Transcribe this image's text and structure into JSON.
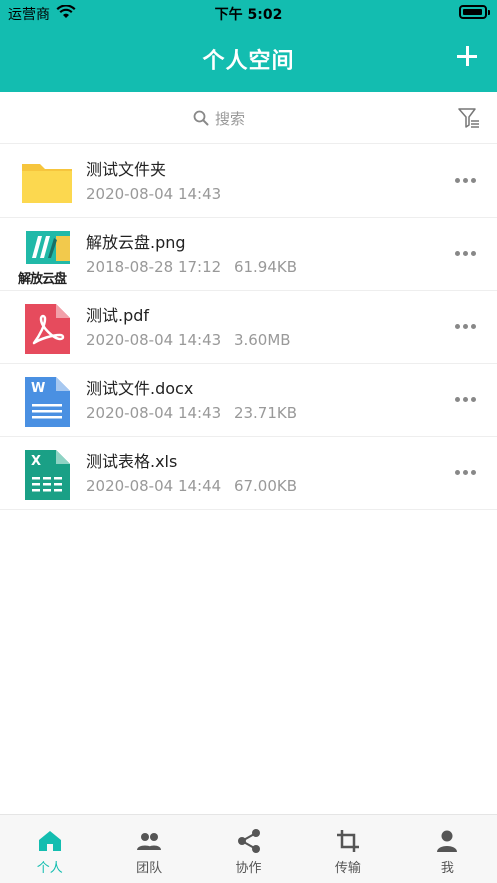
{
  "status_bar": {
    "carrier": "运营商",
    "time": "下午 5:02"
  },
  "header": {
    "title": "个人空间",
    "add_icon": "plus-icon"
  },
  "search": {
    "placeholder": "搜索",
    "filter_icon": "filter-icon"
  },
  "files": [
    {
      "name": "测试文件夹",
      "date": "2020-08-04 14:43",
      "size": "",
      "type": "folder"
    },
    {
      "name": "解放云盘.png",
      "date": "2018-08-28 17:12",
      "size": "61.94KB",
      "type": "image",
      "logo_text": "解放云盘"
    },
    {
      "name": "测试.pdf",
      "date": "2020-08-04 14:43",
      "size": "3.60MB",
      "type": "pdf"
    },
    {
      "name": "测试文件.docx",
      "date": "2020-08-04 14:43",
      "size": "23.71KB",
      "type": "docx",
      "badge": "W"
    },
    {
      "name": "测试表格.xls",
      "date": "2020-08-04 14:44",
      "size": "67.00KB",
      "type": "xls",
      "badge": "X"
    }
  ],
  "tabs": [
    {
      "label": "个人",
      "icon": "home-icon",
      "active": true
    },
    {
      "label": "团队",
      "icon": "team-icon",
      "active": false
    },
    {
      "label": "协作",
      "icon": "share-icon",
      "active": false
    },
    {
      "label": "传输",
      "icon": "transfer-icon",
      "active": false
    },
    {
      "label": "我",
      "icon": "person-icon",
      "active": false
    }
  ],
  "colors": {
    "accent": "#13bdb0",
    "folder": "#fcd34d",
    "pdf": "#e64b5d",
    "docx": "#4a90e2",
    "xls": "#1aa086",
    "text_muted": "#999999"
  }
}
